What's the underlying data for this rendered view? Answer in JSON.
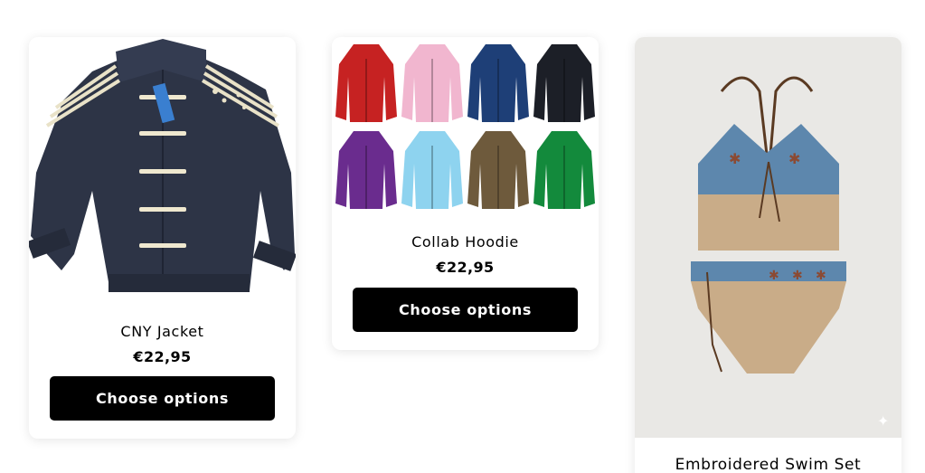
{
  "products": [
    {
      "title": "CNY Jacket",
      "price": "€22,95",
      "button_label": "Choose options",
      "image_name": "navy track jacket with cream toggles"
    },
    {
      "title": "Collab Hoodie",
      "price": "€22,95",
      "button_label": "Choose options",
      "image_name": "grid of eight camo zip hoodies"
    },
    {
      "title": "Embroidered Swim Set",
      "image_name": "denim and tan bikini set"
    }
  ],
  "colors": {
    "button": "#000000",
    "card_bg": "#ffffff",
    "jacket_navy": "#2d3446",
    "denim": "#5d87ad",
    "tan": "#c9ac88"
  },
  "hoodie_colors": [
    "#c62222",
    "#f1b6cf",
    "#1e3f77",
    "#1c1f27",
    "#6a2c8e",
    "#8ed3ef",
    "#6e5a3c",
    "#138a3c"
  ]
}
